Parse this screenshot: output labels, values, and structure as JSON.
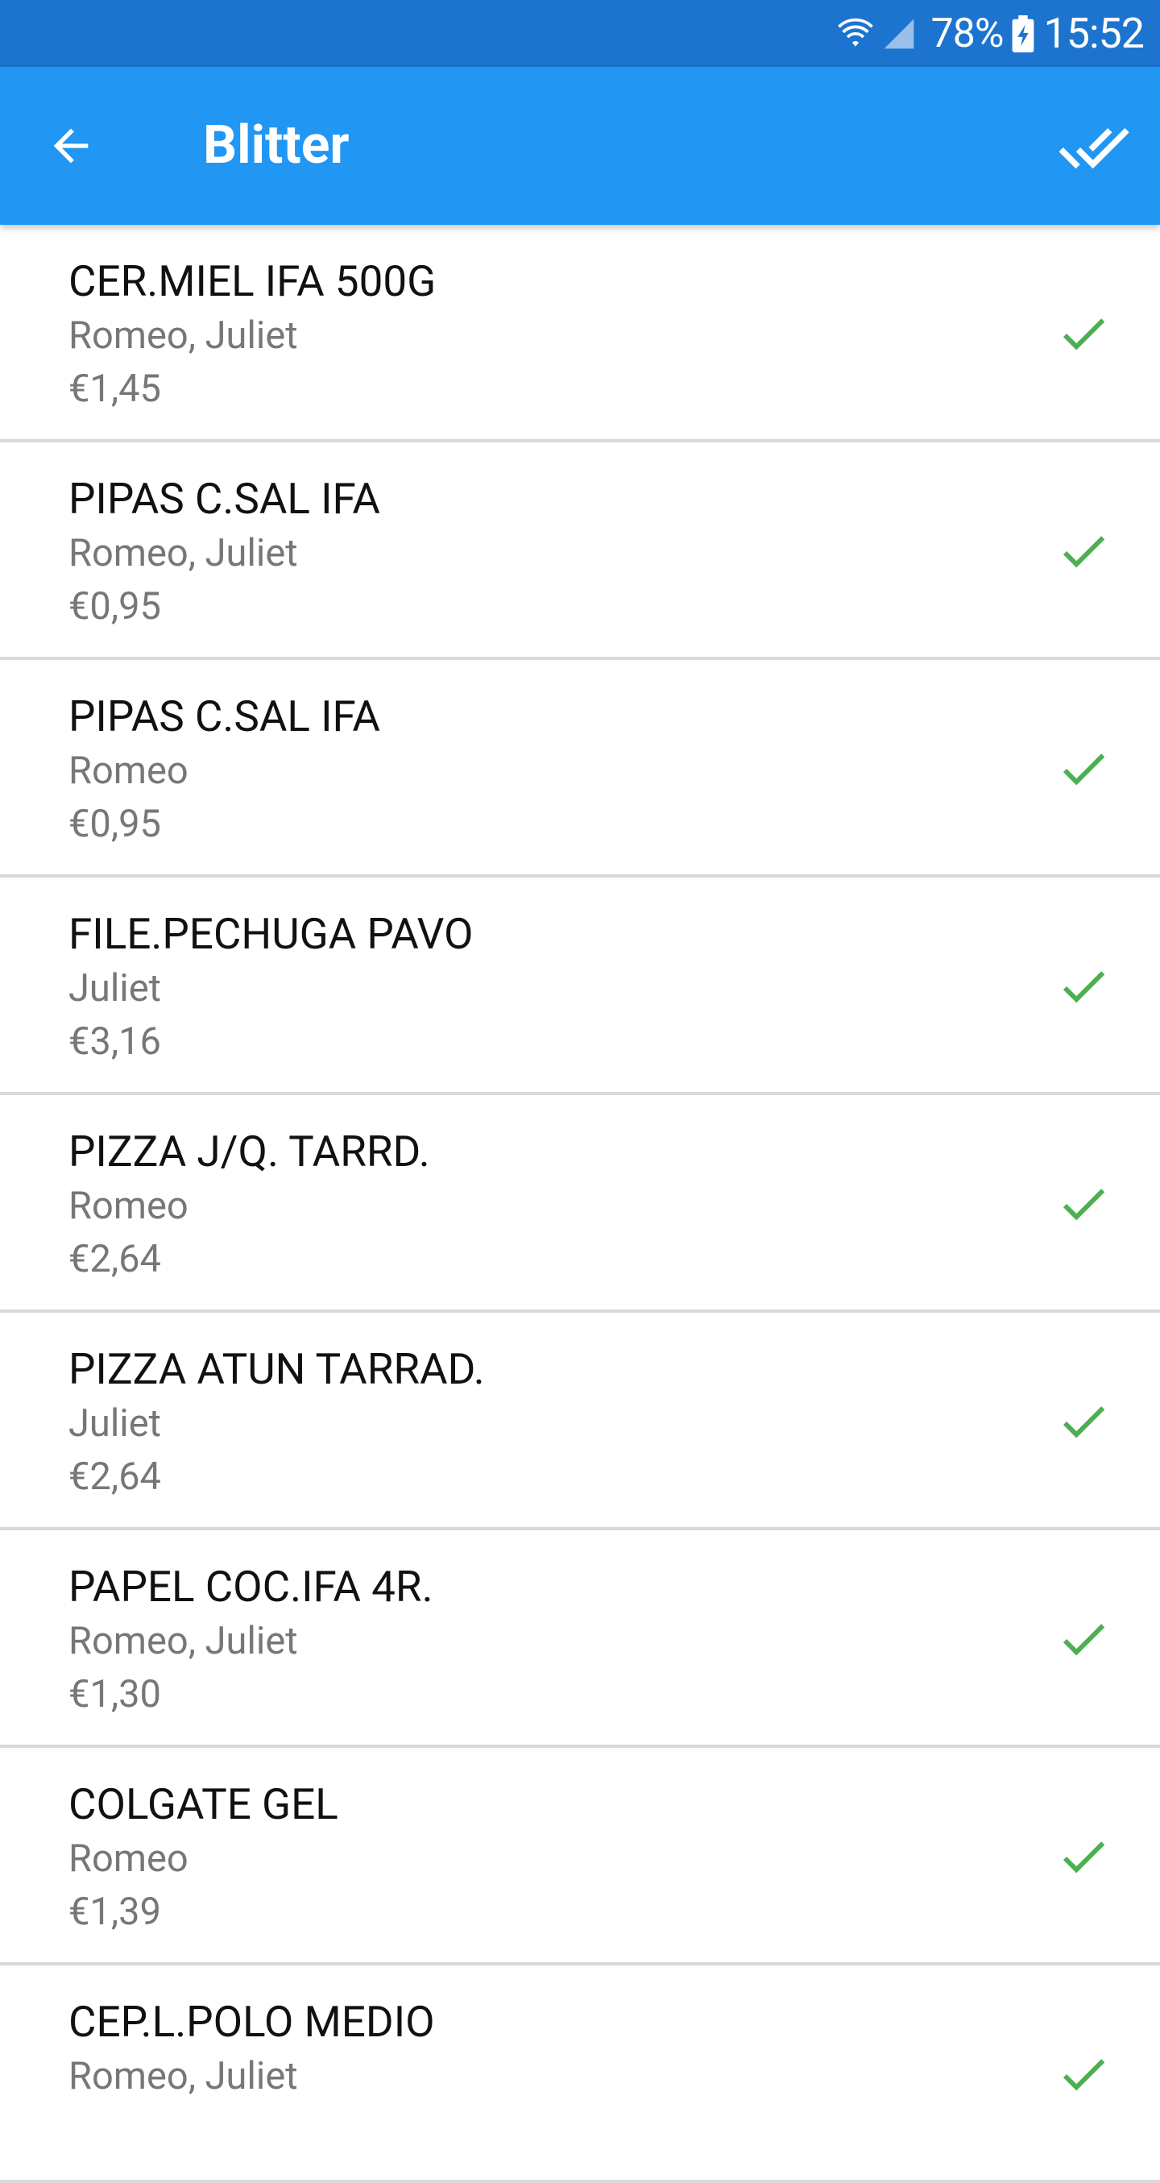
{
  "status_bar": {
    "battery_percent": "78%",
    "time": "15:52",
    "icons": [
      "wifi-icon",
      "signal-icon",
      "battery-charging-icon"
    ]
  },
  "app_bar": {
    "title": "Blitter",
    "back_icon": "arrow-back-icon",
    "action_icon": "done-all-icon"
  },
  "colors": {
    "status_bar": "#1c74cf",
    "app_bar": "#2196f3",
    "check": "#4caf50",
    "divider": "#d9d9d9",
    "secondary_text": "#777777"
  },
  "items": [
    {
      "name": "CER.MIEL IFA 500G",
      "people": "Romeo, Juliet",
      "price": "€1,45",
      "checked": true
    },
    {
      "name": "PIPAS C.SAL IFA",
      "people": "Romeo, Juliet",
      "price": "€0,95",
      "checked": true
    },
    {
      "name": "PIPAS C.SAL IFA",
      "people": "Romeo",
      "price": "€0,95",
      "checked": true
    },
    {
      "name": "FILE.PECHUGA PAVO",
      "people": "Juliet",
      "price": "€3,16",
      "checked": true
    },
    {
      "name": "PIZZA J/Q. TARRD.",
      "people": "Romeo",
      "price": "€2,64",
      "checked": true
    },
    {
      "name": "PIZZA ATUN TARRAD.",
      "people": "Juliet",
      "price": "€2,64",
      "checked": true
    },
    {
      "name": "PAPEL COC.IFA 4R.",
      "people": "Romeo, Juliet",
      "price": "€1,30",
      "checked": true
    },
    {
      "name": "COLGATE GEL",
      "people": "Romeo",
      "price": "€1,39",
      "checked": true
    },
    {
      "name": "CEP.L.POLO MEDIO",
      "people": "Romeo, Juliet",
      "price": "",
      "checked": true
    }
  ]
}
